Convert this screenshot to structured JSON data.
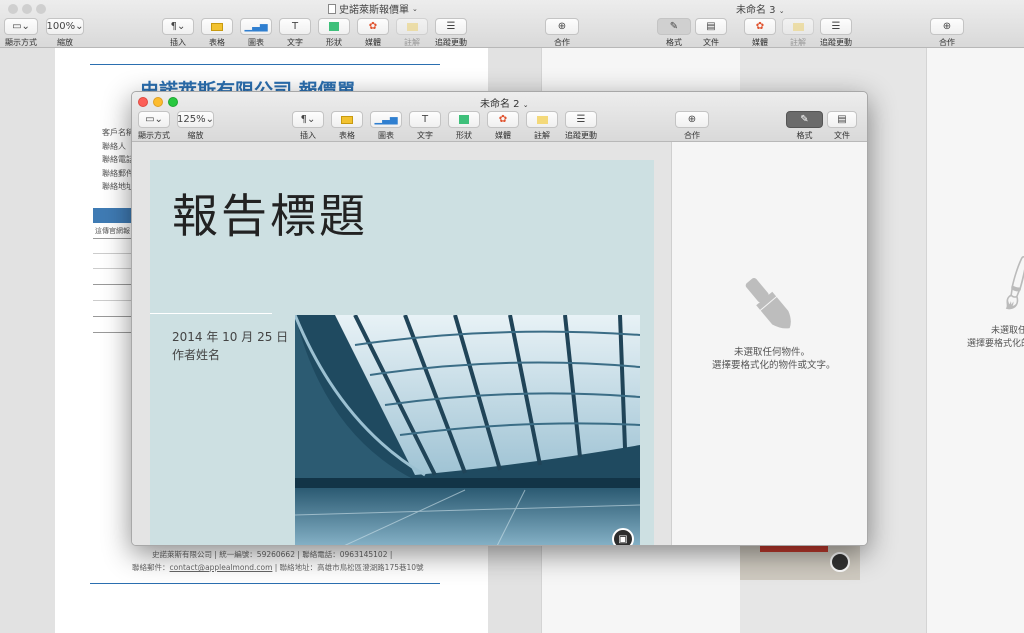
{
  "back_window_left": {
    "title": "史諾萊斯報價單",
    "toolbar": {
      "view": "顯示方式",
      "zoom_value": "100%",
      "zoom": "縮放",
      "insert": "插入",
      "table": "表格",
      "chart": "圖表",
      "text": "文字",
      "shape": "形狀",
      "media": "媒體",
      "comment": "註解",
      "track_changes": "追蹤更動",
      "collaborate": "合作",
      "format": "格式",
      "document": "文件"
    },
    "doc": {
      "company_heading": "史諾萊斯有限公司  報價單",
      "fields": [
        "客戶名稱",
        "聯絡人",
        "聯絡電話",
        "聯絡郵件",
        "聯絡地址"
      ],
      "table_note": "這傳官網報",
      "footer_line1": "史諾萊斯有限公司 | 統一編號：59260662 | 聯絡電話：0963145102 |",
      "footer_line2_prefix": "聯絡郵件：",
      "footer_email": "contact@applealmond.com",
      "footer_line2_suffix": " | 聯絡地址：高雄市鳥松區澄湖路175巷10號"
    }
  },
  "back_window_right": {
    "title": "未命名 3",
    "toolbar": {
      "media": "媒體",
      "comment": "註解",
      "track_changes": "追蹤更動",
      "collaborate": "合作"
    },
    "inspector": {
      "line1": "未選取任",
      "line2": "選擇要格式化的"
    }
  },
  "front_window": {
    "title": "未命名 2",
    "toolbar": {
      "view": "顯示方式",
      "zoom_value": "125%",
      "zoom": "縮放",
      "insert": "插入",
      "table": "表格",
      "chart": "圖表",
      "text": "文字",
      "shape": "形狀",
      "media": "媒體",
      "comment": "註解",
      "track_changes": "追蹤更動",
      "collaborate": "合作",
      "format": "格式",
      "document": "文件"
    },
    "report": {
      "title": "報告標題",
      "date": "2014 年 10 月 25 日",
      "author": "作者姓名"
    },
    "inspector": {
      "line1": "未選取任何物件。",
      "line2": "選擇要格式化的物件或文字。"
    }
  },
  "colors": {
    "heading_blue": "#2b6fb0",
    "cover_bg": "#cde0e2",
    "table_header_blue": "#3f7bb4"
  }
}
